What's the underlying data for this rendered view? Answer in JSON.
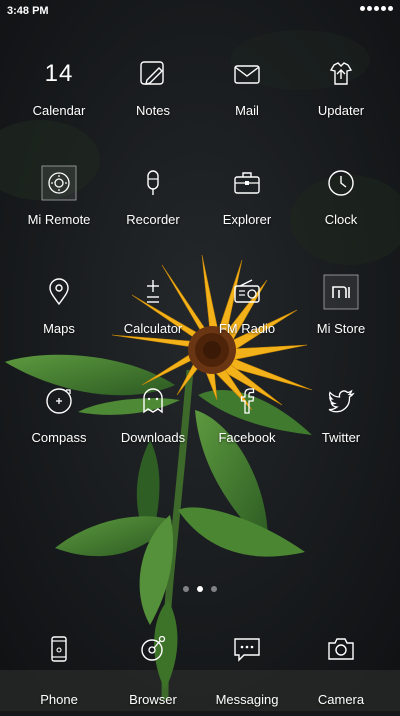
{
  "status_bar": {
    "time": "3:48 PM",
    "signal_icon": "signal-dots-icon"
  },
  "apps": [
    {
      "label": "Calendar",
      "icon": "calendar-icon",
      "text": "14"
    },
    {
      "label": "Notes",
      "icon": "notes-icon"
    },
    {
      "label": "Mail",
      "icon": "mail-icon"
    },
    {
      "label": "Updater",
      "icon": "updater-icon"
    },
    {
      "label": "Mi Remote",
      "icon": "mi-remote-icon"
    },
    {
      "label": "Recorder",
      "icon": "recorder-icon"
    },
    {
      "label": "Explorer",
      "icon": "explorer-icon"
    },
    {
      "label": "Clock",
      "icon": "clock-icon"
    },
    {
      "label": "Maps",
      "icon": "maps-icon"
    },
    {
      "label": "Calculator",
      "icon": "calculator-icon"
    },
    {
      "label": "FM Radio",
      "icon": "fm-radio-icon"
    },
    {
      "label": "Mi Store",
      "icon": "mi-store-icon"
    },
    {
      "label": "Compass",
      "icon": "compass-icon"
    },
    {
      "label": "Downloads",
      "icon": "downloads-icon"
    },
    {
      "label": "Facebook",
      "icon": "facebook-icon"
    },
    {
      "label": "Twitter",
      "icon": "twitter-icon"
    }
  ],
  "page_indicator": {
    "pages": 3,
    "active_index": 1
  },
  "dock": [
    {
      "label": "Phone",
      "icon": "phone-icon"
    },
    {
      "label": "Browser",
      "icon": "browser-icon"
    },
    {
      "label": "Messaging",
      "icon": "messaging-icon"
    },
    {
      "label": "Camera",
      "icon": "camera-icon"
    }
  ],
  "colors": {
    "background": "#15171a",
    "flower_petal": "#f4b21a",
    "flower_center": "#5a2a10",
    "leaf": "#3f7a2e"
  }
}
